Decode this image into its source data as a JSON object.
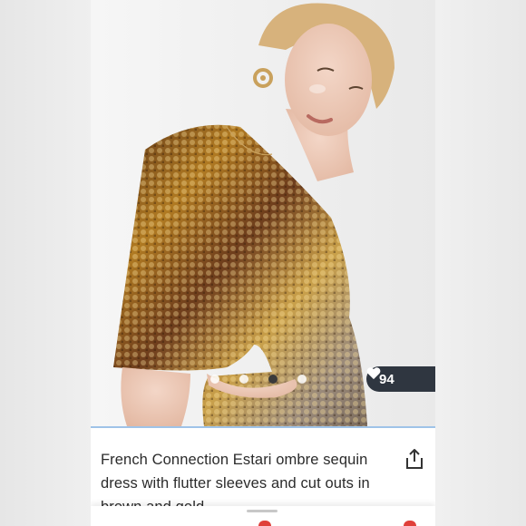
{
  "listing": {
    "title": "French Connection Estari ombre sequin dress with flutter sleeves and cut outs in brown and gold",
    "likes": "94"
  },
  "carousel": {
    "total_dots": 4,
    "active_index": 2
  },
  "icons": {
    "like": "heart-icon",
    "share": "share-icon"
  },
  "colors": {
    "likes_pill": "#2f3640",
    "divider": "#9fc3e8",
    "accent": "#e0403a"
  }
}
